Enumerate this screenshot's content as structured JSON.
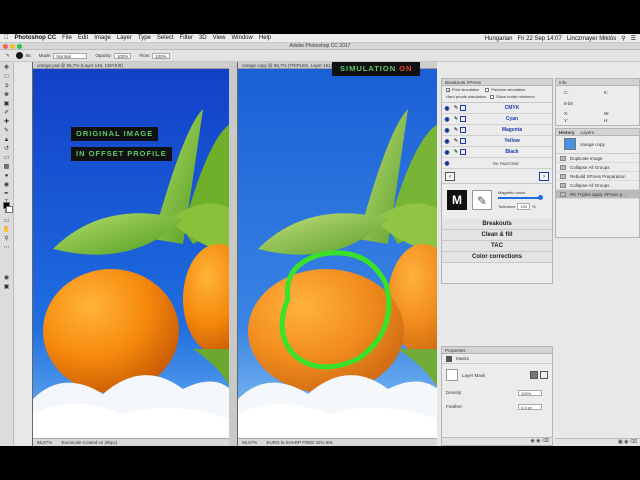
{
  "menubar": {
    "apple": "",
    "items": [
      "Photoshop CC",
      "File",
      "Edit",
      "Image",
      "Layer",
      "Type",
      "Select",
      "Filter",
      "3D",
      "View",
      "Window",
      "Help"
    ],
    "language": "Hungarian",
    "clock": "Fri 22 Sep 14:07",
    "user": "Linczmayer Miklós"
  },
  "window": {
    "title": "Adobe Photoshop CC 2017"
  },
  "options_bar": {
    "size_value": "85",
    "mode_label": "Mode:",
    "mode_value": "Normal",
    "opacity_label": "Opacity:",
    "opacity_value": "100%",
    "flow_label": "Flow:",
    "flow_value": "100%"
  },
  "documents": {
    "left": {
      "tab": "orange.psd @ 66,7% (Layer 146, CMYK/8)",
      "zoom": "66,67%",
      "profile": "Euroscale Coated v2 (8bpc)"
    },
    "right": {
      "tab": "orange copy @ 66,7% (TRIPLES, Layer 151)",
      "zoom": "66,67%",
      "profile": "EURO la SHARP FREE 32% 60L"
    }
  },
  "overlays": {
    "original_line1": "ORIGINAL IMAGE",
    "original_line2": "IN OFFSET PROFILE",
    "simulation": "SIMULATION",
    "simulation_state": "ON"
  },
  "xpress_panel": {
    "title": "Breakouts XPress",
    "print_simulation": "Print simulation",
    "pantone_simulation": "Pantone simulation",
    "hard_proof": "Hard proofs simulation",
    "show_under": "Show under minimum",
    "channels": [
      "CMYK",
      "Cyan",
      "Magenta",
      "Yellow",
      "Black"
    ],
    "pantone_label": "RK PANTONE",
    "prev_arrow": "‹",
    "next_arrow": "›",
    "logo_letter": "M",
    "magnetic_brush": "Magnetic brush",
    "tolerance_label": "Tolerance",
    "tolerance_value": "100",
    "tolerance_unit": "%",
    "buttons": [
      "Breakouts",
      "Clean & fill",
      "TAC",
      "Color corrections"
    ]
  },
  "info_panel": {
    "title": "Info",
    "c_label": "C:",
    "k_label": "K:",
    "bit_label": "8-bit",
    "x_label": "X:",
    "y_label": "Y:",
    "w_label": "W:",
    "h_label": "H:"
  },
  "history_panel": {
    "tabs": [
      "History",
      "Layers"
    ],
    "snapshot": "orange copy",
    "items": [
      "Duplicate Image",
      "Collapse All Groups",
      "Rebuild XPress Preparation",
      "Collapse All Groups",
      "RK Triples apply XPress p..."
    ]
  },
  "properties_panel": {
    "title": "Properties",
    "masks_label": "Masks",
    "layer_mask": "Layer Mask",
    "density_label": "Density:",
    "density_value": "100%",
    "feather_label": "Feather:",
    "feather_value": "0,0 px"
  },
  "colors": {
    "sim_green": "#5ec96a",
    "sim_on_red": "#e84a2a",
    "circle_green": "#39e12b",
    "channel_blue": "#1e3aa8",
    "sky_blue": "#1a5fd6"
  }
}
